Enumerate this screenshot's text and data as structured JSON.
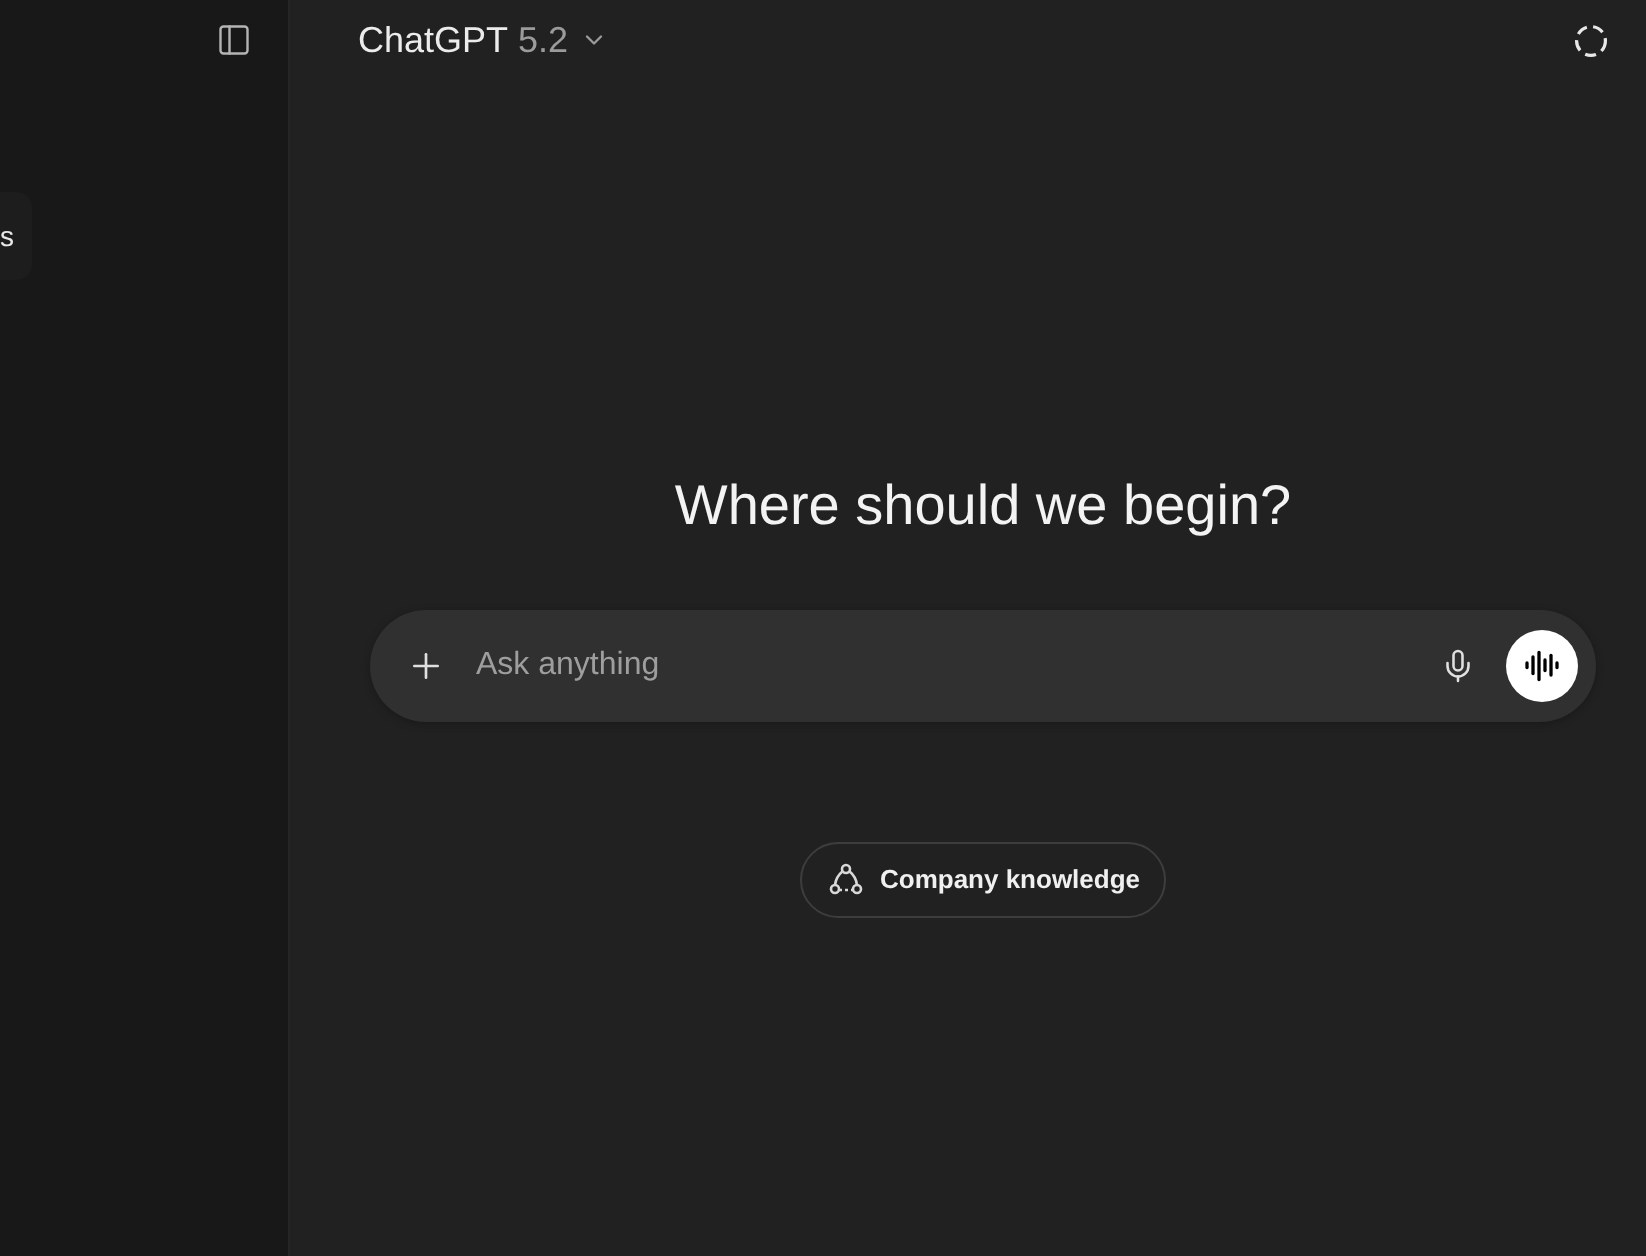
{
  "sidebar": {
    "items": [
      {
        "label": "s"
      }
    ]
  },
  "header": {
    "model_name": "ChatGPT",
    "model_version": "5.2"
  },
  "heading": "Where should we begin?",
  "composer": {
    "placeholder": "Ask anything"
  },
  "suggestions": [
    {
      "label": "Company knowledge"
    }
  ]
}
